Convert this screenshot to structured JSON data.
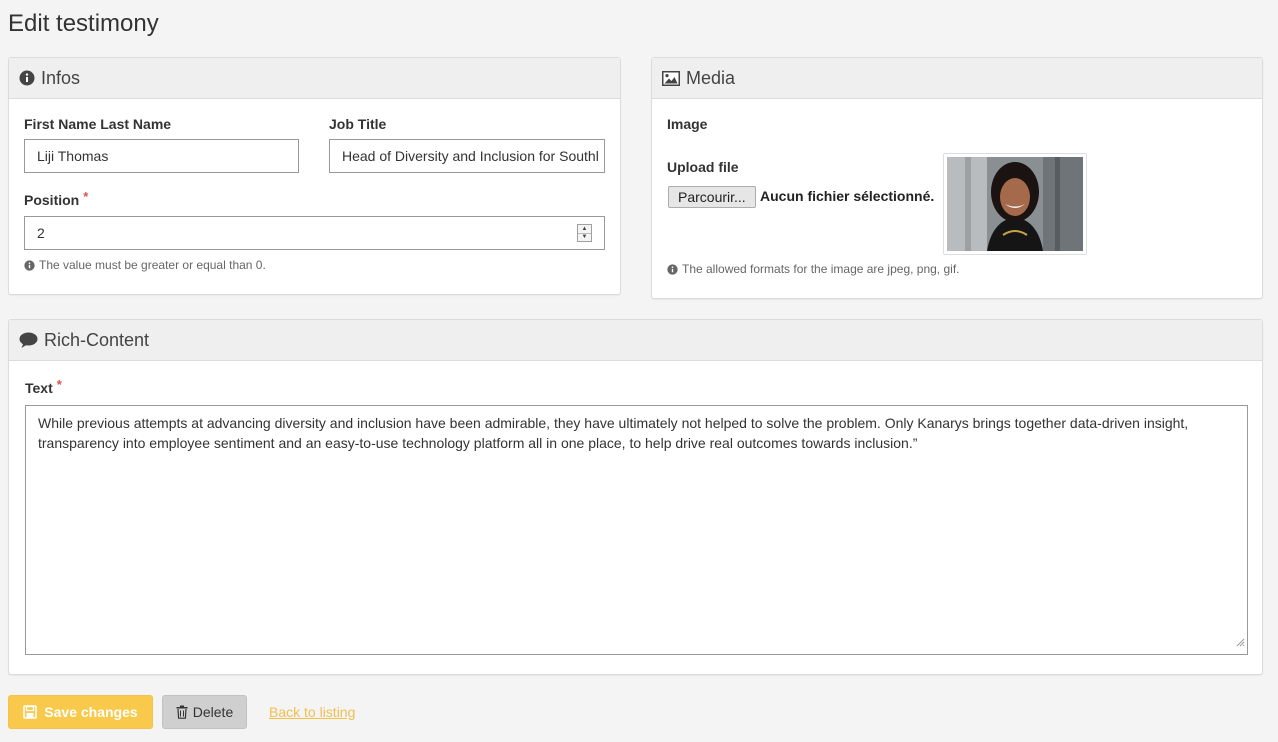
{
  "page": {
    "title": "Edit testimony"
  },
  "infos": {
    "heading": "Infos",
    "name_label": "First Name Last Name",
    "name_value": "Liji Thomas",
    "job_label": "Job Title",
    "job_value": "Head of Diversity and Inclusion for Southl",
    "position_label": "Position",
    "required_mark": "*",
    "position_value": "2",
    "position_help": "The value must be greater or equal than 0."
  },
  "media": {
    "heading": "Media",
    "image_label": "Image",
    "upload_label": "Upload file",
    "browse_button": "Parcourir...",
    "file_status": "Aucun fichier sélectionné.",
    "help": "The allowed formats for the image are jpeg, png, gif."
  },
  "rich_content": {
    "heading": "Rich-Content",
    "text_label": "Text",
    "required_mark": "*",
    "text_value": "While previous attempts at advancing diversity and inclusion have been admirable, they have ultimately not helped to solve the problem. Only Kanarys brings together data-driven insight, transparency into employee sentiment and an easy-to-use technology platform all in one place, to help drive real outcomes towards inclusion.”"
  },
  "actions": {
    "save_label": "Save changes",
    "delete_label": "Delete",
    "back_label": "Back to listing"
  },
  "colors": {
    "accent": "#f8c94a",
    "required": "#d9534f",
    "link": "#f0c04e",
    "panel_heading_bg": "#efefef",
    "page_bg": "#f4f4f4"
  },
  "icons": {
    "infos": "info-circle-icon",
    "media": "picture-icon",
    "rich_content": "comment-icon",
    "save": "floppy-disk-icon",
    "delete": "trash-icon",
    "help": "info-circle-icon"
  }
}
